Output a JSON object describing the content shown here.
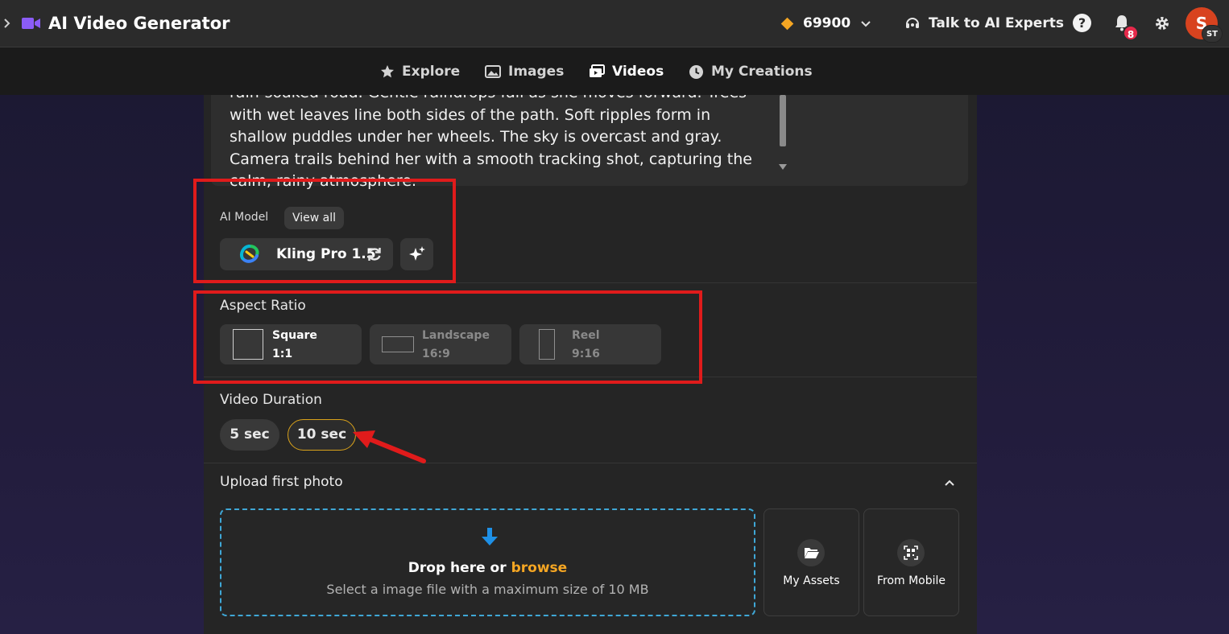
{
  "app": {
    "title": "AI Video Generator"
  },
  "header": {
    "credits": "69900",
    "talk_label": "Talk to AI Experts",
    "help_glyph": "?",
    "notifications_count": "8",
    "avatar_initial": "S",
    "avatar_sub": "ST"
  },
  "nav": {
    "items": [
      {
        "label": "Explore",
        "icon": "star-icon"
      },
      {
        "label": "Images",
        "icon": "image-icon"
      },
      {
        "label": "Videos",
        "icon": "video-gallery-icon",
        "active": true
      },
      {
        "label": "My Creations",
        "icon": "clock-icon"
      }
    ]
  },
  "prompt": {
    "lines": [
      "rain-soaked road. Gentle raindrops fall as she moves forward. Trees",
      "with wet leaves line both sides of the path. Soft ripples form in",
      "shallow puddles under her wheels. The sky is overcast and gray.",
      "Camera trails behind her with a smooth tracking shot, capturing the",
      "calm, rainy atmosphere."
    ]
  },
  "model": {
    "label": "AI Model",
    "view_all": "View all",
    "name": "Kling Pro 1.5"
  },
  "aspect": {
    "label": "Aspect Ratio",
    "options": [
      {
        "name": "Square",
        "ratio": "1:1",
        "selected": true
      },
      {
        "name": "Landscape",
        "ratio": "16:9",
        "selected": false
      },
      {
        "name": "Reel",
        "ratio": "9:16",
        "selected": false
      }
    ]
  },
  "duration": {
    "label": "Video Duration",
    "options": [
      {
        "label": "5 sec",
        "selected": false
      },
      {
        "label": "10 sec",
        "selected": true
      }
    ]
  },
  "upload": {
    "title": "Upload first photo",
    "drop_text": "Drop here or",
    "browse": "browse",
    "subtext": "Select a image file with a maximum size of 10 MB",
    "my_assets": "My Assets",
    "from_mobile": "From Mobile"
  },
  "colors": {
    "accent": "#f5a623",
    "annotation_red": "#e01b1b",
    "dropzone_border": "#3fa7d6"
  }
}
